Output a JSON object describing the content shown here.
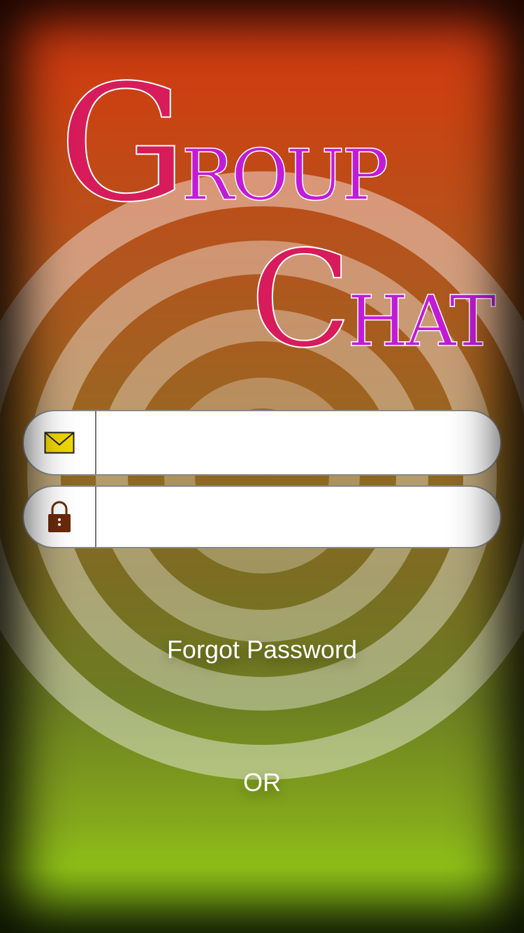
{
  "title": {
    "line1_cap": "G",
    "line1_rest": "ROUP",
    "line2_cap": "C",
    "line2_rest": "HAT"
  },
  "login": {
    "email_icon": "envelope-icon",
    "password_icon": "padlock-icon",
    "email_value": "",
    "password_value": "",
    "forgot_password_label": "Forgot Password",
    "or_label": "OR"
  },
  "colors": {
    "title_capital": "#d81b5a",
    "title_rest": "#c21bd8",
    "envelope": "#f0d800",
    "padlock": "#6b2a0a"
  }
}
